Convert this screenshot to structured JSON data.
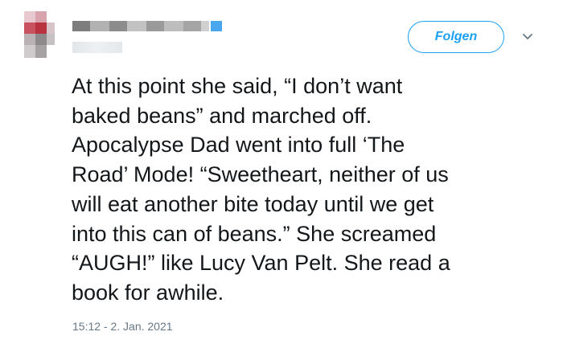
{
  "follow_button": {
    "label": "Folgen"
  },
  "icons": {
    "more": "chevron-down-icon"
  },
  "tweet": {
    "text": "At this point she said, “I don’t want\nbaked beans” and marched off.\nApocalypse Dad went into full ‘The\nRoad’ Mode! “Sweetheart, neither of us\nwill eat another bite today until we get\ninto this can of beans.” She screamed\n“AUGH!” like Lucy Van Pelt. She read a\nbook for awhile.",
    "timestamp": "15:12 - 2. Jan. 2021"
  },
  "colors": {
    "accent": "#1da1f2",
    "text": "#14171a",
    "muted": "#657786"
  }
}
